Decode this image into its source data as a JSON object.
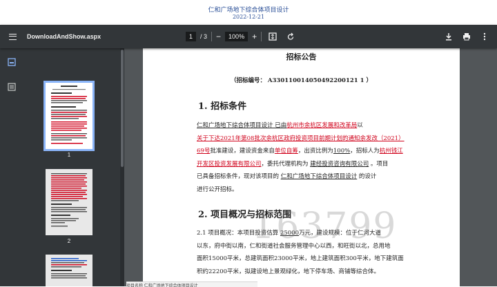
{
  "page": {
    "heading": "仁和广场地下综合体项目设计",
    "date": "2022-12-21"
  },
  "toolbar": {
    "filename": "DownloadAndShow.aspx",
    "page_current": "1",
    "page_total": "/  3",
    "zoom": "100%",
    "zoom_out_label": "−",
    "zoom_in_label": "+"
  },
  "sidebar": {
    "thumbnails": [
      {
        "label": "1"
      },
      {
        "label": "2"
      }
    ]
  },
  "document": {
    "title": "招标公告",
    "bid_number": "（招标编号：    A330110014050492200121 1        ）",
    "section1_heading": "1.   招标条件",
    "section1_lines": [
      [
        "      仁和广场地下综合体项目设计     已由",
        "杭州市余杭区发展和改革局",
        "以"
      ],
      [
        "关于下达2021年第08批次余杭区政府投资项目前期计划的通知余发改（2021）"
      ],
      [
        "69号",
        "批准建设，建设资金来自",
        "单位自筹",
        "，出资比例为",
        "100%",
        "，招标人为",
        "杭州钱江"
      ],
      [
        "开发区投资发展有限公司",
        "，委托代理机构为      ",
        "建经投资咨询有限公司",
        "      。项目"
      ],
      [
        "已具备招标条件，现对该项目的     ",
        "仁和广场地下综合体项目设计",
        "     的设计"
      ],
      [
        "进行公开招标。"
      ]
    ],
    "section2_heading": "2.   项目概况与招标范围",
    "section2_lines": [
      [
        "      2.1  项目概况：本项目投资估算  ",
        "25000",
        "万元，建设规模：位于仁河大道"
      ],
      [
        "以东，府中街以南，仁和街道社会服务管理中心以西，和旺街以北，总用地"
      ],
      [
        "面积15000平米，总建筑面积23000平米，地上建筑面积300平米，地下建筑面"
      ],
      [
        "积约22200平米，拟建设地上景观绿化，地下停车场、商铺等综合体。"
      ]
    ],
    "watermark": "163799"
  },
  "bottom": {
    "text": "项目名称    仁和广场地下综合体项目设计"
  }
}
